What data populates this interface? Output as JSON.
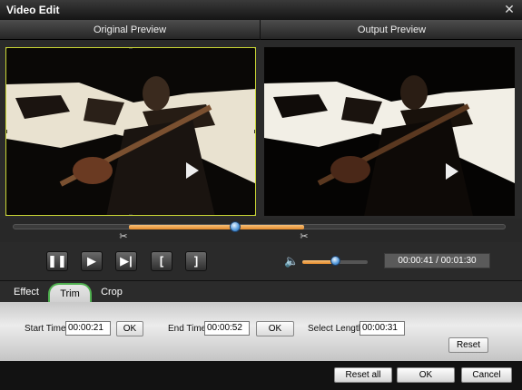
{
  "window": {
    "title": "Video Edit"
  },
  "preview": {
    "original_label": "Original Preview",
    "output_label": "Output Preview"
  },
  "timeline": {
    "selection_start_fraction": 0.236,
    "selection_end_fraction": 0.592,
    "playhead_fraction": 0.455
  },
  "player": {
    "pause_icon": "pause-icon",
    "play_icon": "play-icon",
    "step_icon": "next-frame-icon",
    "mark_in_label": "[",
    "mark_out_label": "]",
    "volume_level": 0.5,
    "timecode": "00:00:41 / 00:01:30"
  },
  "tabs": [
    {
      "label": "Effect"
    },
    {
      "label": "Trim",
      "active": true
    },
    {
      "label": "Crop"
    }
  ],
  "trim": {
    "start_label": "Start Time",
    "start_value": "00:00:21",
    "start_ok": "OK",
    "end_label": "End Time",
    "end_value": "00:00:52",
    "end_ok": "OK",
    "length_label": "Select Length",
    "length_value": "00:00:31",
    "reset_label": "Reset"
  },
  "footer": {
    "reset_all": "Reset all",
    "ok": "OK",
    "cancel": "Cancel"
  },
  "colors": {
    "accent_orange": "#e48a2a",
    "thumb_blue": "#4f96d9",
    "crop_border": "#c9d634",
    "tab_highlight": "#4fb04f"
  }
}
